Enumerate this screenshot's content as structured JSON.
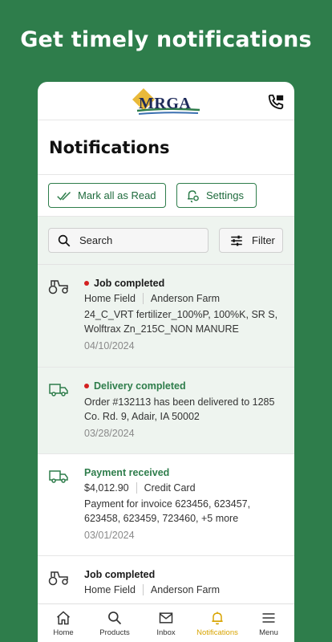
{
  "headline": "Get timely notifications",
  "logo": {
    "text": "MRGA"
  },
  "page_title": "Notifications",
  "actions": {
    "mark_all": "Mark all as Read",
    "settings": "Settings"
  },
  "search": {
    "placeholder": "Search",
    "filter": "Filter"
  },
  "notifications": [
    {
      "icon": "tractor-icon",
      "unread": true,
      "title": "Job completed",
      "title_color": "#1a1a1a",
      "meta_left": "Home Field",
      "meta_right": "Anderson Farm",
      "body": "24_C_VRT fertilizer_100%P, 100%K, SR S, Wolftrax Zn_215C_NON MANURE",
      "date": "04/10/2024"
    },
    {
      "icon": "truck-icon",
      "unread": true,
      "title": "Delivery completed",
      "title_color": "#2e7d4b",
      "body": "Order #132113 has been delivered to 1285 Co. Rd. 9, Adair, IA 50002",
      "date": "03/28/2024"
    },
    {
      "icon": "truck-icon",
      "unread": false,
      "title": "Payment received",
      "title_color": "#2e7d4b",
      "meta_left": "$4,012.90",
      "meta_right": "Credit Card",
      "body": "Payment for invoice 623456, 623457, 623458, 623459, 723460, +5 more",
      "date": "03/01/2024"
    },
    {
      "icon": "tractor-icon",
      "unread": false,
      "title": "Job completed",
      "title_color": "#1a1a1a",
      "meta_left": "Home Field",
      "meta_right": "Anderson Farm"
    }
  ],
  "tabs": [
    {
      "label": "Home",
      "icon": "home-icon",
      "active": false
    },
    {
      "label": "Products",
      "icon": "search-icon",
      "active": false
    },
    {
      "label": "Inbox",
      "icon": "mail-icon",
      "active": false
    },
    {
      "label": "Notifications",
      "icon": "bell-icon",
      "active": true
    },
    {
      "label": "Menu",
      "icon": "menu-icon",
      "active": false
    }
  ],
  "colors": {
    "brand_green": "#2e7d4b",
    "active_tab": "#d8a400",
    "unread_dot": "#d32020"
  }
}
